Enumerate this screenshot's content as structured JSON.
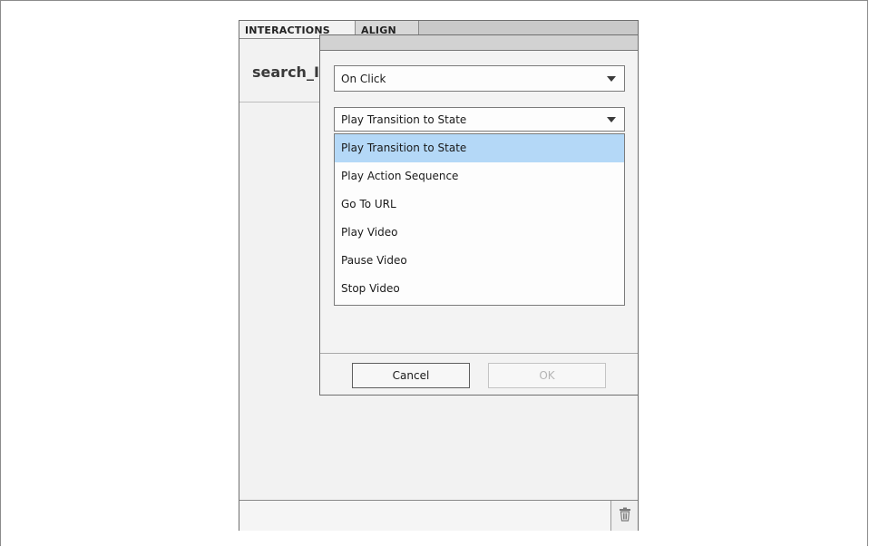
{
  "panel": {
    "tabs": [
      {
        "label": "INTERACTIONS"
      },
      {
        "label": "ALIGN"
      }
    ],
    "title": "search_I"
  },
  "dialog": {
    "event_select": {
      "value": "On Click"
    },
    "action_select": {
      "value": "Play Transition to State"
    },
    "action_options": [
      "Play Transition to State",
      "Play Action Sequence",
      "Go To URL",
      "Play Video",
      "Pause Video",
      "Stop Video"
    ],
    "selected_option_index": 0,
    "cancel_label": "Cancel",
    "ok_label": "OK"
  },
  "icons": {
    "footer_icon": "trash-icon",
    "select_arrow": "chevron-down-icon"
  },
  "colors": {
    "highlight": "#b4d8f7",
    "panel_bg": "#f2f2f2",
    "tabbar_bg": "#c9c9c9"
  }
}
